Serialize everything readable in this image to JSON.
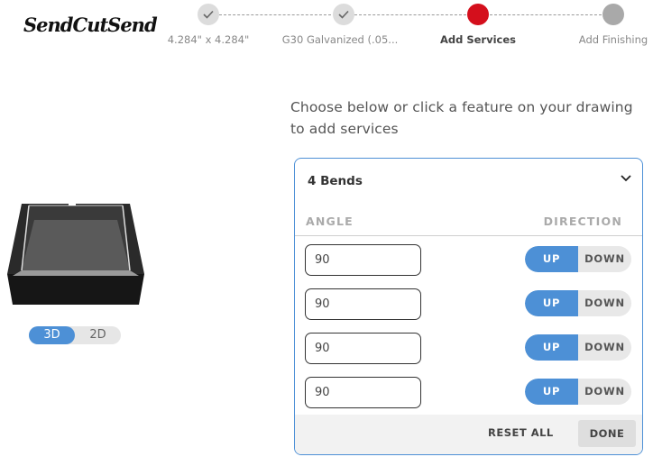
{
  "logo": {
    "text": "SendCutSend"
  },
  "stepper": {
    "steps": [
      {
        "label": "4.284\" x 4.284\"",
        "state": "done"
      },
      {
        "label": "G30 Galvanized (.05...",
        "state": "done"
      },
      {
        "label": "Add Services",
        "state": "active"
      },
      {
        "label": "Add Finishing",
        "state": "future"
      }
    ]
  },
  "viewer": {
    "toggle": {
      "option_3d": "3D",
      "option_2d": "2D",
      "selected": "3D"
    }
  },
  "instruction": "Choose below or click a feature on your drawing to add services",
  "services_panel": {
    "title": "4 Bends",
    "col_angle": "ANGLE",
    "col_direction": "DIRECTION",
    "bends": [
      {
        "angle": "90",
        "up_label": "UP",
        "down_label": "DOWN",
        "selected": "UP"
      },
      {
        "angle": "90",
        "up_label": "UP",
        "down_label": "DOWN",
        "selected": "UP"
      },
      {
        "angle": "90",
        "up_label": "UP",
        "down_label": "DOWN",
        "selected": "UP"
      },
      {
        "angle": "90",
        "up_label": "UP",
        "down_label": "DOWN",
        "selected": "UP"
      }
    ],
    "reset_label": "RESET ALL",
    "done_label": "DONE"
  },
  "colors": {
    "accent_blue": "#4d90d6",
    "active_step_red": "#d40f1c",
    "done_step_gray": "#dcdcdc",
    "future_step_gray": "#a9a9a9"
  }
}
